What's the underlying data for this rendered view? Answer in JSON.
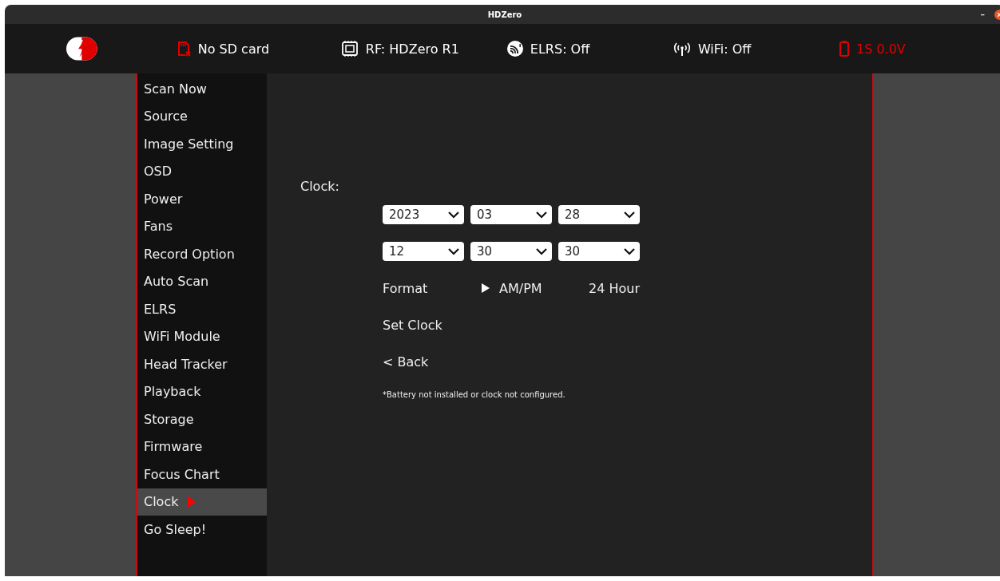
{
  "window": {
    "title": "HDZero",
    "controls": [
      "–"
    ]
  },
  "status_bar": [
    {
      "kind": "sd",
      "text": "No SD card",
      "color": "#ffffff"
    },
    {
      "kind": "chip",
      "text": "RF: HDZero R1",
      "color": "#ffffff"
    },
    {
      "kind": "elrs",
      "text": "ELRS: Off",
      "color": "#ffffff"
    },
    {
      "kind": "wifi",
      "text": "WiFi: Off",
      "color": "#ffffff"
    },
    {
      "kind": "battery",
      "text": "1S 0.0V",
      "color": "#e00000"
    }
  ],
  "sidebar": {
    "items": [
      {
        "label": "Scan Now",
        "selected": false
      },
      {
        "label": "Source",
        "selected": false
      },
      {
        "label": "Image Setting",
        "selected": false
      },
      {
        "label": "OSD",
        "selected": false
      },
      {
        "label": "Power",
        "selected": false
      },
      {
        "label": "Fans",
        "selected": false
      },
      {
        "label": "Record Option",
        "selected": false
      },
      {
        "label": "Auto Scan",
        "selected": false
      },
      {
        "label": "ELRS",
        "selected": false
      },
      {
        "label": "WiFi Module",
        "selected": false
      },
      {
        "label": "Head Tracker",
        "selected": false
      },
      {
        "label": "Playback",
        "selected": false
      },
      {
        "label": "Storage",
        "selected": false
      },
      {
        "label": "Firmware",
        "selected": false
      },
      {
        "label": "Focus Chart",
        "selected": false
      },
      {
        "label": "Clock",
        "selected": true
      },
      {
        "label": "Go Sleep!",
        "selected": false
      }
    ]
  },
  "clock": {
    "heading": "Clock:",
    "date": [
      "2023",
      "03",
      "28"
    ],
    "time": [
      "12",
      "30",
      "30"
    ],
    "format": {
      "label": "Format",
      "options": [
        {
          "label": "AM/PM",
          "selected": true
        },
        {
          "label": "24 Hour",
          "selected": false
        }
      ]
    },
    "set_clock": "Set Clock",
    "back": "< Back",
    "note": "*Battery not installed or clock not configured."
  }
}
